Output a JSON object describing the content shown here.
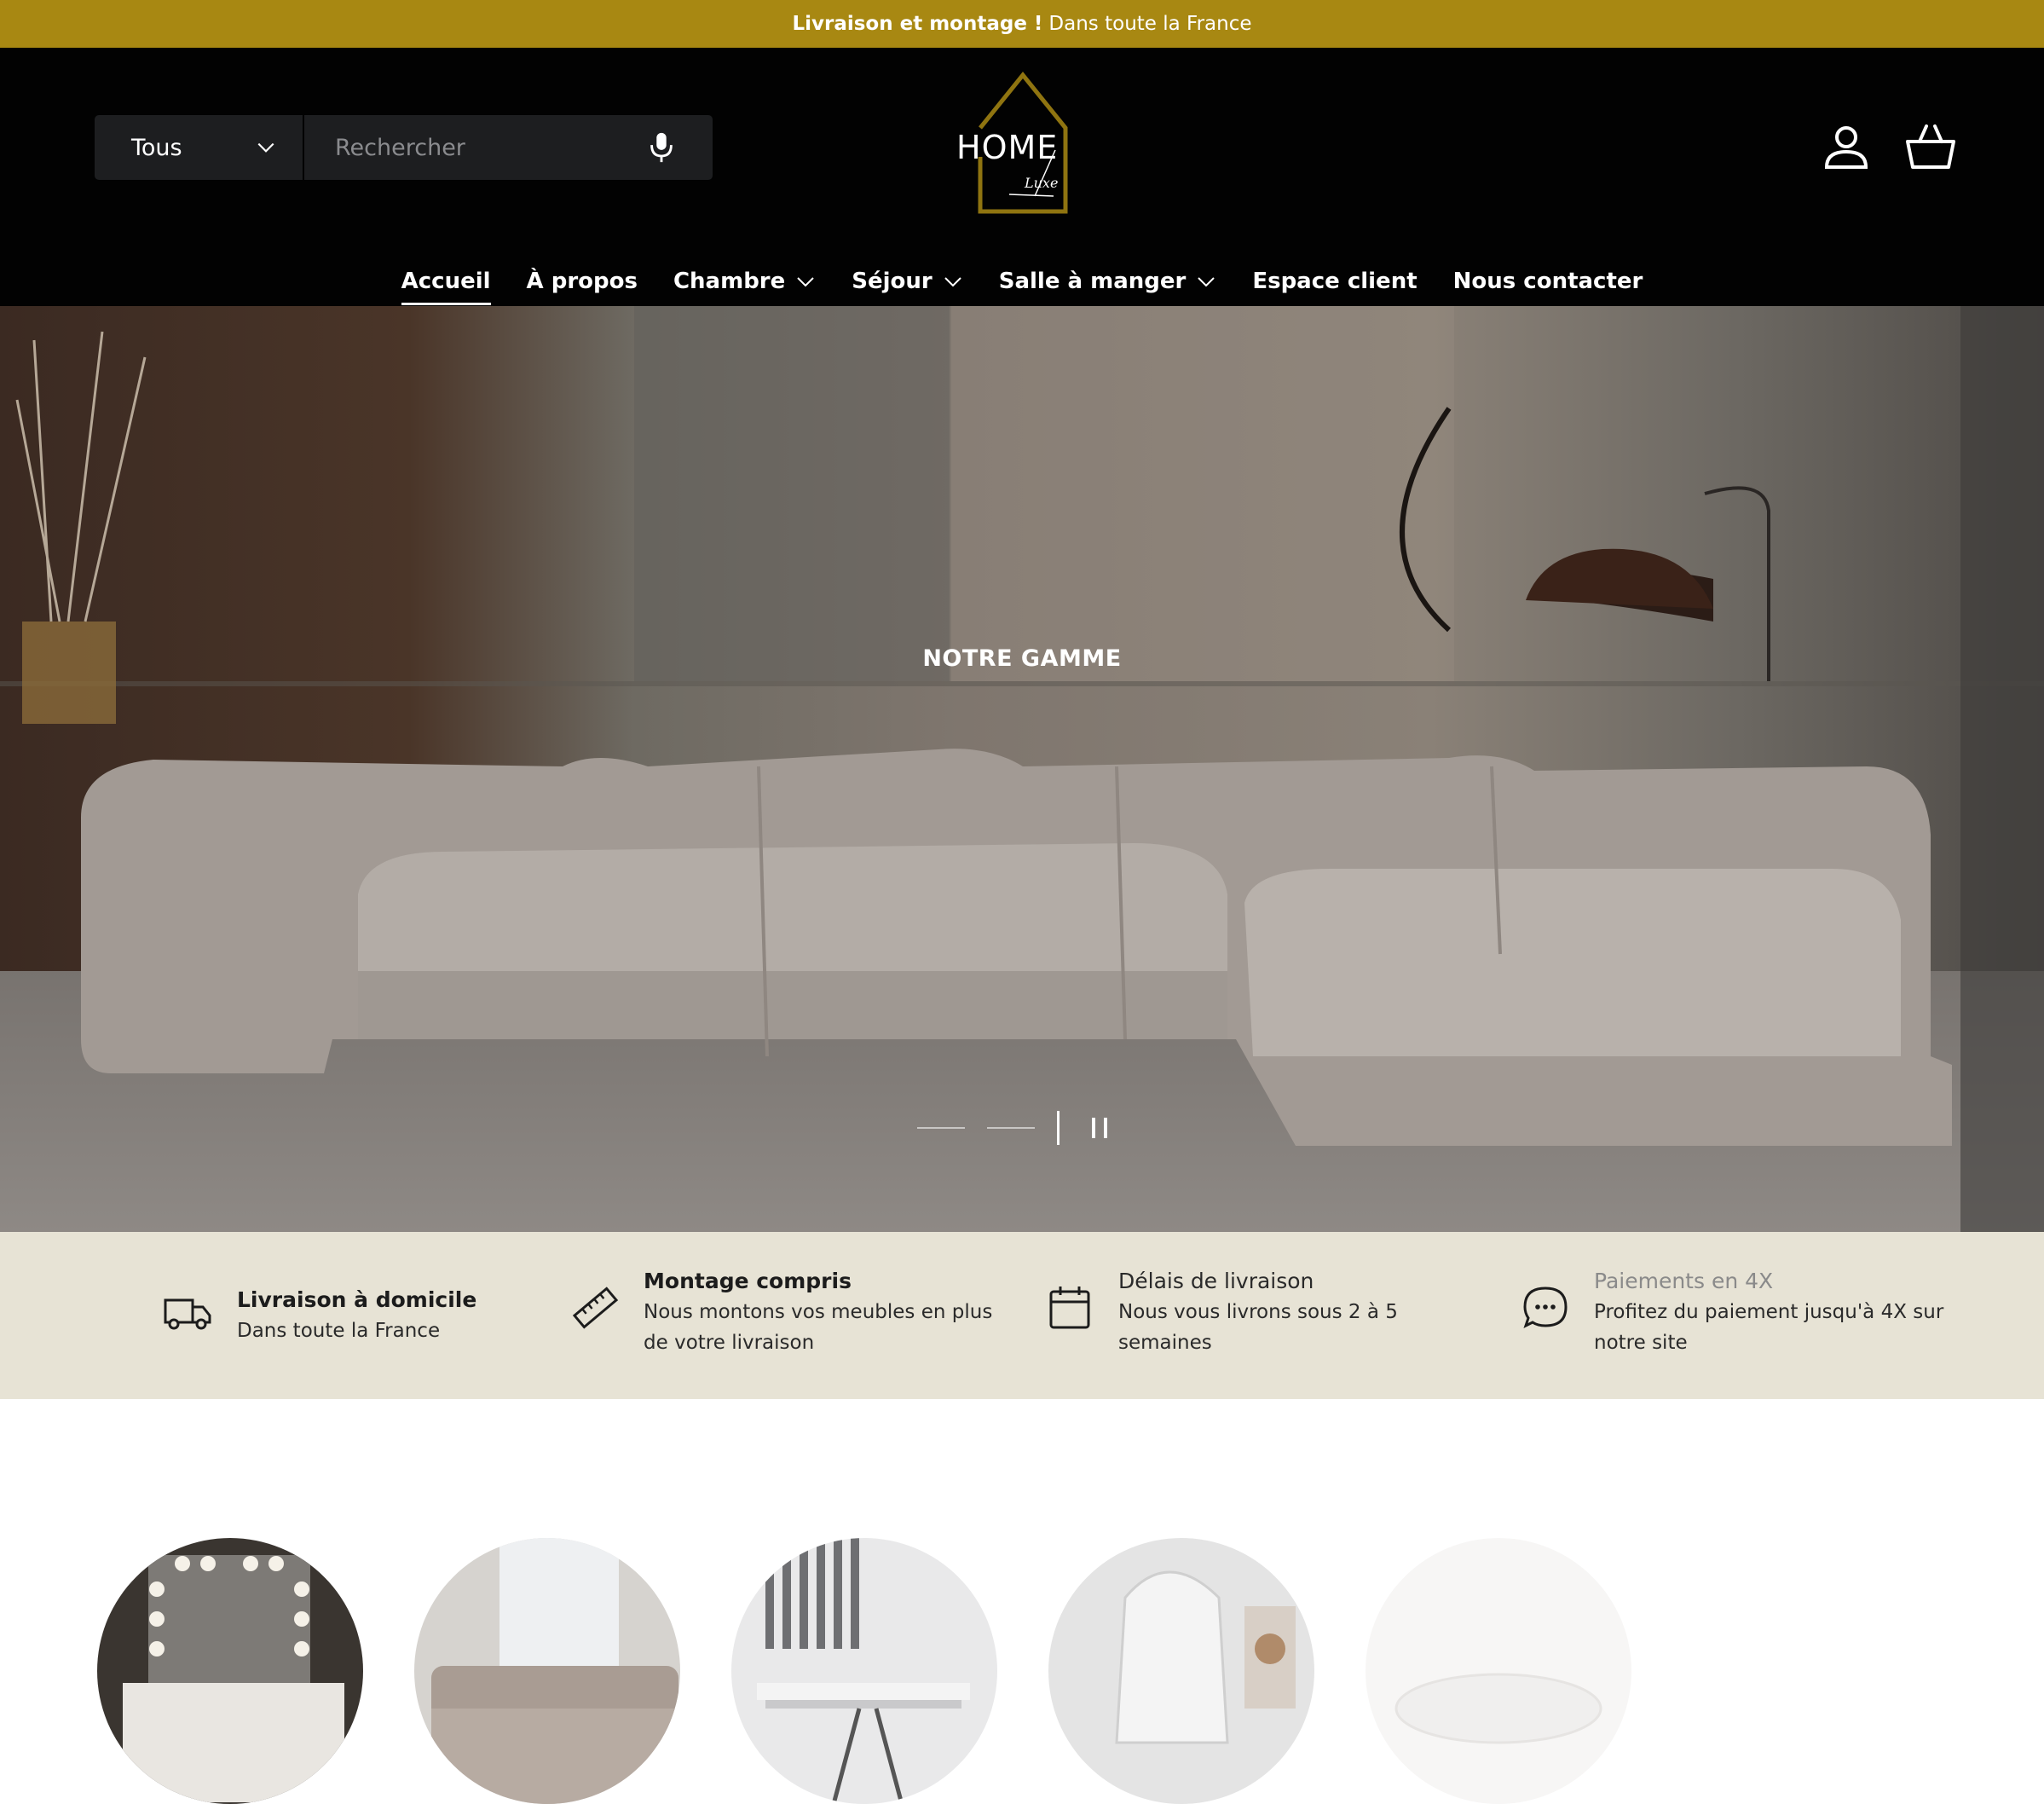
{
  "announcement": {
    "bold": "Livraison et montage !",
    "text": "Dans toute la France"
  },
  "search": {
    "category": "Tous",
    "placeholder": "Rechercher"
  },
  "logo": {
    "word": "HOME",
    "script": "Luxe"
  },
  "nav": [
    {
      "label": "Accueil",
      "dropdown": false,
      "active": true
    },
    {
      "label": "À propos",
      "dropdown": false
    },
    {
      "label": "Chambre",
      "dropdown": true
    },
    {
      "label": "Séjour",
      "dropdown": true
    },
    {
      "label": "Salle à manger",
      "dropdown": true
    },
    {
      "label": "Espace client",
      "dropdown": false
    },
    {
      "label": "Nous contacter",
      "dropdown": false
    }
  ],
  "hero": {
    "title": "NOTRE GAMME"
  },
  "benefits": [
    {
      "icon": "truck-icon",
      "title": "Livraison à domicile",
      "desc": "Dans toute la France"
    },
    {
      "icon": "ruler-icon",
      "title": "Montage compris",
      "desc": "Nous montons vos meubles en plus de votre livraison"
    },
    {
      "icon": "calendar-icon",
      "title": "Délais de livraison",
      "desc": "Nous vous livrons sous 2 à 5 semaines"
    },
    {
      "icon": "chat-icon",
      "title": "Paiements en 4X",
      "desc": "Profitez du paiement jusqu'à 4X sur notre site"
    }
  ],
  "colors": {
    "gold": "#a88812",
    "header": "#020202",
    "benefits_bg": "#e7e3d5"
  }
}
